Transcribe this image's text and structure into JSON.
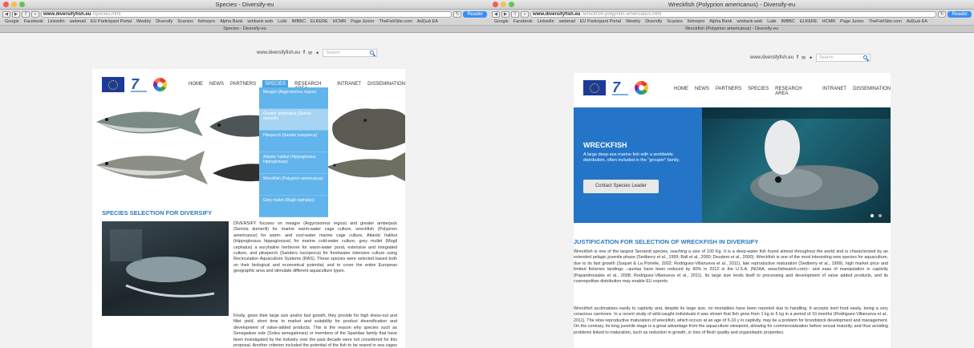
{
  "left": {
    "window_title": "Species - Diversify-eu",
    "url_domain": "www.diversifyfish.eu",
    "url_path": "/species.html",
    "reader": "Reader",
    "bookmarks": [
      "Google",
      "Facebook",
      "LinkedIn",
      "webmail",
      "EU Participant Portal",
      "Weebly",
      "Diversify",
      "Scanios",
      "fishrepro",
      "Alpha Bank",
      "winbank web",
      "Luiki",
      "IMBBC",
      "ELKERE",
      "HCMR",
      "Page Junior",
      "TheFishSite.com",
      "Αείξωά ΕΑ"
    ],
    "tab": "Species - Diversify-eu",
    "site_url": "www.diversifyfish.eu",
    "search_placeholder": "Search",
    "nav": [
      "HOME",
      "NEWS",
      "PARTNERS",
      "SPECIES",
      "RESEARCH AREA",
      "INTRANET",
      "DISSEMINATION"
    ],
    "dropdown": [
      "Meagre (Argyrosomus regius)",
      "Greater amberjack (Seriola dumerili)",
      "Pikeperch (Sander lucioperca)",
      "Atlantic halibut (Hippoglossus hippoglossus)",
      "Wreckfish (Polyprion americanus)",
      "Grey mullet (Mugil cephalus)"
    ],
    "heading": "SPECIES SELECTION FOR DIVERSIFY",
    "p1": "DIVERSIFY focuses on meagre (Argyrosomus regius) and greater amberjack (Seriola dumerili) for marine warm-water cage culture, wreckfish (Polyprion americanus) for warm- and cool-water marine cage culture, Atlantic halibut (Hippoglossus hippoglossus) for marine cold-water culture, grey mullet (Mugil cephalus) a euryhaline herbivore for warm-water pond, extensive and integrated culture, and pikeperch (Sanders lucioperca) for freshwater intensive culture using Recirculation Aquaculture Systems (RAS). These species were selected based both on their biological and economical potential, and to cover the entire European geographic area and stimulate different aquaculture types.",
    "p2": "Firstly, given their large size and/or fast growth, they provide for high dress-out and fillet yield, short time to market and suitability for product diversification and development of value-added products. This is the reason why species such as Senegalese sole (Solea senegalensis) or members of the Sparidae family that have been investigated by the industry over the past decade were not considered for this proposal. Another criterion included the potential of the fish to be reared in sea cages --especially offshore,"
  },
  "right": {
    "window_title": "Wreckfish (Polyprion americanus) - Diversify-eu",
    "url_domain": "www.diversifyfish.eu",
    "url_path": "/wreckfish-polyprion-americanus.html",
    "reader": "Reader",
    "bookmarks": [
      "Google",
      "Facebook",
      "LinkedIn",
      "webmail",
      "EU Participant Portal",
      "Weebly",
      "Diversify",
      "Scanios",
      "fishrepro",
      "Alpha Bank",
      "winbank web",
      "Luiki",
      "IMBBC",
      "ELKERE",
      "HCMR",
      "Page Junior",
      "TheFishSite.com",
      "Αείξωά ΕΑ"
    ],
    "tab": "Wreckfish (Polyprion americanus) - Diversify-eu",
    "site_url": "www.diversifyfish.eu",
    "search_placeholder": "Search",
    "nav": [
      "HOME",
      "NEWS",
      "PARTNERS",
      "SPECIES",
      "RESEARCH AREA",
      "INTRANET",
      "DISSEMINATION"
    ],
    "hero_title": "WRECKFISH",
    "hero_text": "A large deep-sea marine fish with a worldwide distribution, often included in the \"grouper\" family.",
    "hero_button": "Contact Species Leader",
    "heading": "JUSTIFICATION FOR SELECTION OF WRECKFISH IN DIVERSIFY",
    "p1": "Wreckfish is one of the largest Serranid species, reaching a size of 100 Kg. It is a deep-water fish found almost throughout the world and is characterized by an extended pelagic juvenile phase (Sedberry et al., 1999; Ball et al., 2000; Deudero et al., 2000). Wreckfish is one of the most interesting new species for aquaculture, due to its fast growth (Suquet & La Pomèle, 2002; Rodriguez-Villanueva et al., 2011), late reproductive maturation (Sedberry et al., 1999), high market price and limited fisheries landings --quotas have been reduced by 90% in 2012 in the U.S.A. (NOAA, www.fishwatch.com)-- and ease of manipulation in captivity (Papandroulakis et al., 2008; Rodriguez-Villanueva et al., 2011). Its large size lends itself to processing and development of value added products, and its cosmopolitan distribution may enable EU exports.",
    "p2": "Wreckfish acclimatizes easily to captivity and, despite its large size, no mortalities have been reported due to handling. It accepts inert food easily, being a very voracious carnivore. In a recent study of wild-caught individuals it was shown that fish grow from 1 kg to 5 kg in a period of 10 months (Rodriguez-Villanueva et al., 2011). The slow reproductive maturation of wreckfish, which occurs at an age of 5-10 y in captivity, may be a problem for broodstock development and management. On the contrary, its long juvenile stage is a great advantage from the aquaculture viewpoint, allowing for commercialization before sexual maturity, and thus avoiding problems linked to maturation, such as reduction in growth, or loss of flesh quality and organoleptic properties."
  }
}
